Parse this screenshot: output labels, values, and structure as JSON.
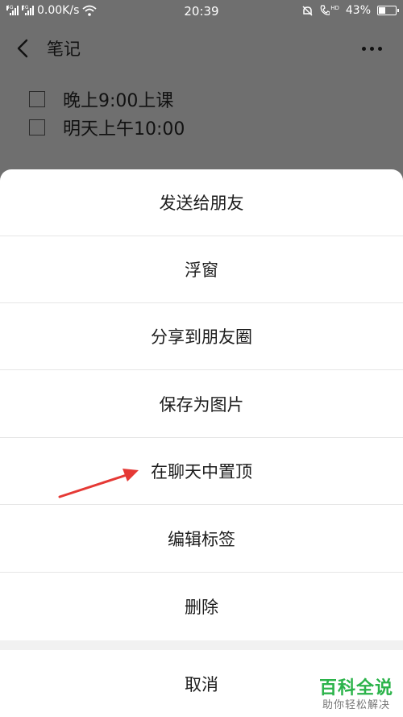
{
  "status_bar": {
    "sim1_label": "4G",
    "sim2_label": "2G",
    "speed": "0.00K/s",
    "time": "20:39",
    "hd_label": "HD",
    "battery": "43%",
    "battery_level": 0.43
  },
  "header": {
    "title": "笔记"
  },
  "notes": [
    {
      "text": "晚上9:00上课",
      "checked": false
    },
    {
      "text": "明天上午10:00",
      "checked": false
    }
  ],
  "sheet": {
    "items": [
      {
        "label": "发送给朋友"
      },
      {
        "label": "浮窗"
      },
      {
        "label": "分享到朋友圈"
      },
      {
        "label": "保存为图片"
      },
      {
        "label": "在聊天中置顶"
      },
      {
        "label": "编辑标签"
      },
      {
        "label": "删除"
      }
    ],
    "cancel": "取消"
  },
  "watermark": {
    "title": "百科全说",
    "subtitle": "助你轻松解决"
  },
  "colors": {
    "overlay": "#6f6f6f",
    "sheet_bg": "#ffffff",
    "annotation_arrow": "#e53935",
    "watermark_green": "#2bb34a"
  }
}
